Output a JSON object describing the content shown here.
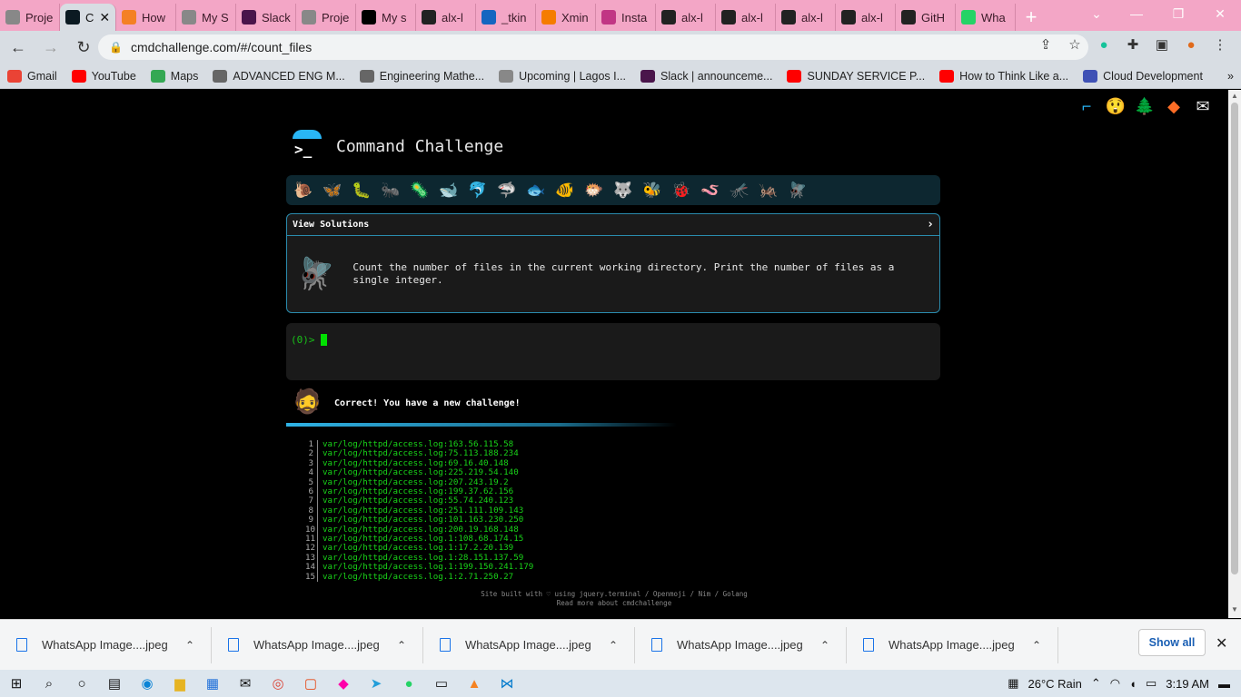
{
  "tabs": [
    {
      "label": "Proje",
      "icon": "alx-icon",
      "color": "#888"
    },
    {
      "label": "C",
      "icon": "terminal-icon",
      "color": "#0b1a22",
      "active": true
    },
    {
      "label": "How",
      "icon": "stackoverflow-icon",
      "color": "#f48024"
    },
    {
      "label": "My S",
      "icon": "alx-icon",
      "color": "#888"
    },
    {
      "label": "Slack",
      "icon": "slack-icon",
      "color": "#4a154b"
    },
    {
      "label": "Proje",
      "icon": "alx-icon",
      "color": "#888"
    },
    {
      "label": "My s",
      "icon": "medium-icon",
      "color": "#000"
    },
    {
      "label": "alx-l",
      "icon": "github-icon",
      "color": "#222"
    },
    {
      "label": "_tkin",
      "icon": "doc-icon",
      "color": "#1565c0"
    },
    {
      "label": "Xmin",
      "icon": "xmind-icon",
      "color": "#f57c00"
    },
    {
      "label": "Insta",
      "icon": "instagram-icon",
      "color": "#c13584"
    },
    {
      "label": "alx-l",
      "icon": "github-icon",
      "color": "#222"
    },
    {
      "label": "alx-l",
      "icon": "github-icon",
      "color": "#222"
    },
    {
      "label": "alx-l",
      "icon": "github-icon",
      "color": "#222"
    },
    {
      "label": "alx-l",
      "icon": "github-icon",
      "color": "#222"
    },
    {
      "label": "GitH",
      "icon": "github-icon",
      "color": "#222"
    },
    {
      "label": "Wha",
      "icon": "whatsapp-icon",
      "color": "#25d366"
    }
  ],
  "toolbar": {
    "url": "cmdchallenge.com/#/count_files"
  },
  "bookmarks": [
    {
      "label": "Gmail",
      "icon": "gmail-icon",
      "color": "#ea4335"
    },
    {
      "label": "YouTube",
      "icon": "youtube-icon",
      "color": "#ff0000"
    },
    {
      "label": "Maps",
      "icon": "maps-icon",
      "color": "#34a853"
    },
    {
      "label": "ADVANCED ENG M...",
      "icon": "globe-icon",
      "color": "#666"
    },
    {
      "label": "Engineering Mathe...",
      "icon": "globe-icon",
      "color": "#666"
    },
    {
      "label": "Upcoming | Lagos I...",
      "icon": "alx-icon",
      "color": "#888"
    },
    {
      "label": "Slack | announceme...",
      "icon": "slack-icon",
      "color": "#4a154b"
    },
    {
      "label": "SUNDAY SERVICE P...",
      "icon": "youtube-icon",
      "color": "#ff0000"
    },
    {
      "label": "How to Think Like a...",
      "icon": "youtube-icon",
      "color": "#ff0000"
    },
    {
      "label": "Cloud Development",
      "icon": "cloud-icon",
      "color": "#3f51b5"
    }
  ],
  "page": {
    "title": "Command Challenge",
    "view_solutions": "View Solutions",
    "challenge_text": "Count the number of files in the current working directory. Print the number of files as a single integer.",
    "prompt": "(0)>",
    "result_text": "Correct! You have a new challenge!",
    "output_lines": [
      "var/log/httpd/access.log:163.56.115.58",
      "var/log/httpd/access.log:75.113.188.234",
      "var/log/httpd/access.log:69.16.40.148",
      "var/log/httpd/access.log:225.219.54.140",
      "var/log/httpd/access.log:207.243.19.2",
      "var/log/httpd/access.log:199.37.62.156",
      "var/log/httpd/access.log:55.74.240.123",
      "var/log/httpd/access.log:251.111.109.143",
      "var/log/httpd/access.log:101.163.230.250",
      "var/log/httpd/access.log:200.19.168.148",
      "var/log/httpd/access.log.1:108.68.174.15",
      "var/log/httpd/access.log.1:17.2.20.139",
      "var/log/httpd/access.log.1:28.151.137.59",
      "var/log/httpd/access.log.1:199.150.241.179",
      "var/log/httpd/access.log.1:2.71.250.27"
    ],
    "footer_line1": "Site built with ♡ using jquery.terminal / Openmoji / Nim / Golang",
    "footer_line2": "Read more about cmdchallenge"
  },
  "downloads": {
    "items": [
      "WhatsApp Image....jpeg",
      "WhatsApp Image....jpeg",
      "WhatsApp Image....jpeg",
      "WhatsApp Image....jpeg",
      "WhatsApp Image....jpeg"
    ],
    "show_all": "Show all"
  },
  "taskbar": {
    "weather": "26°C  Rain",
    "time": "3:19 AM"
  }
}
